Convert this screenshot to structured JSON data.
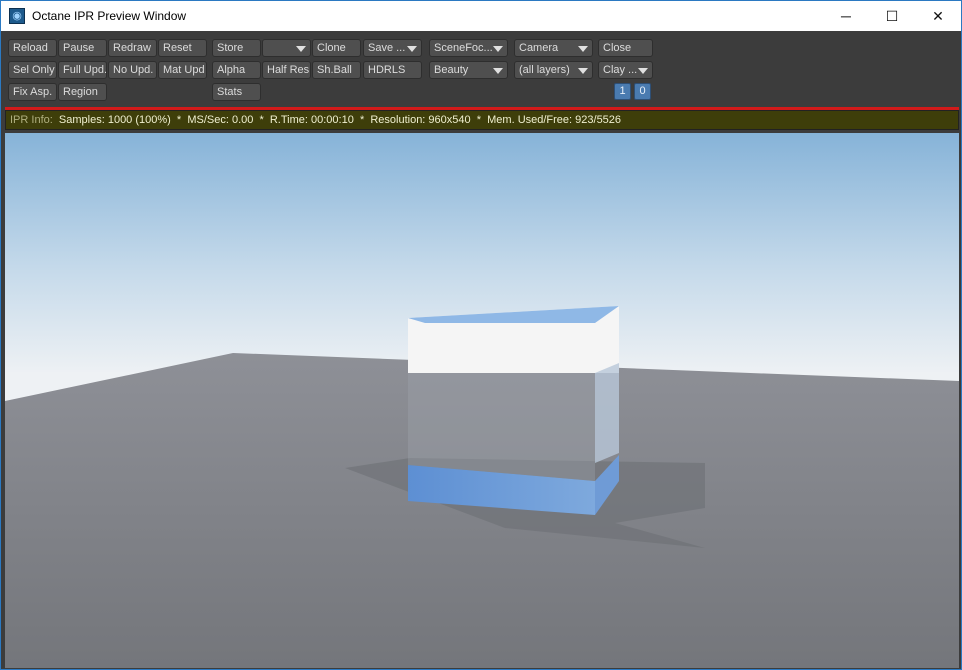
{
  "window": {
    "title": "Octane IPR Preview Window",
    "minimize": "─",
    "maximize": "☐",
    "close": "✕"
  },
  "toolbar": {
    "row1": [
      "Reload",
      "Pause",
      "Redraw",
      "Reset",
      "Store",
      "",
      "Clone",
      "Save ...",
      "SceneFoc...",
      "Camera",
      "Close"
    ],
    "row2": [
      "Sel Only",
      "Full Upd.",
      "No Upd.",
      "Mat Upd",
      "Alpha",
      "Half Res",
      "Sh.Ball",
      "HDRLS",
      "Beauty",
      "(all layers)",
      "Clay ..."
    ],
    "row3": [
      "Fix Asp.",
      "Region",
      "Stats"
    ],
    "counters": [
      "1",
      "0"
    ]
  },
  "info": {
    "label": "IPR Info:",
    "text": "Samples: 1000 (100%)  *  MS/Sec: 0.00  *  R.Time: 00:00:10  *  Resolution: 960x540  *  Mem. Used/Free: 923/5526"
  }
}
